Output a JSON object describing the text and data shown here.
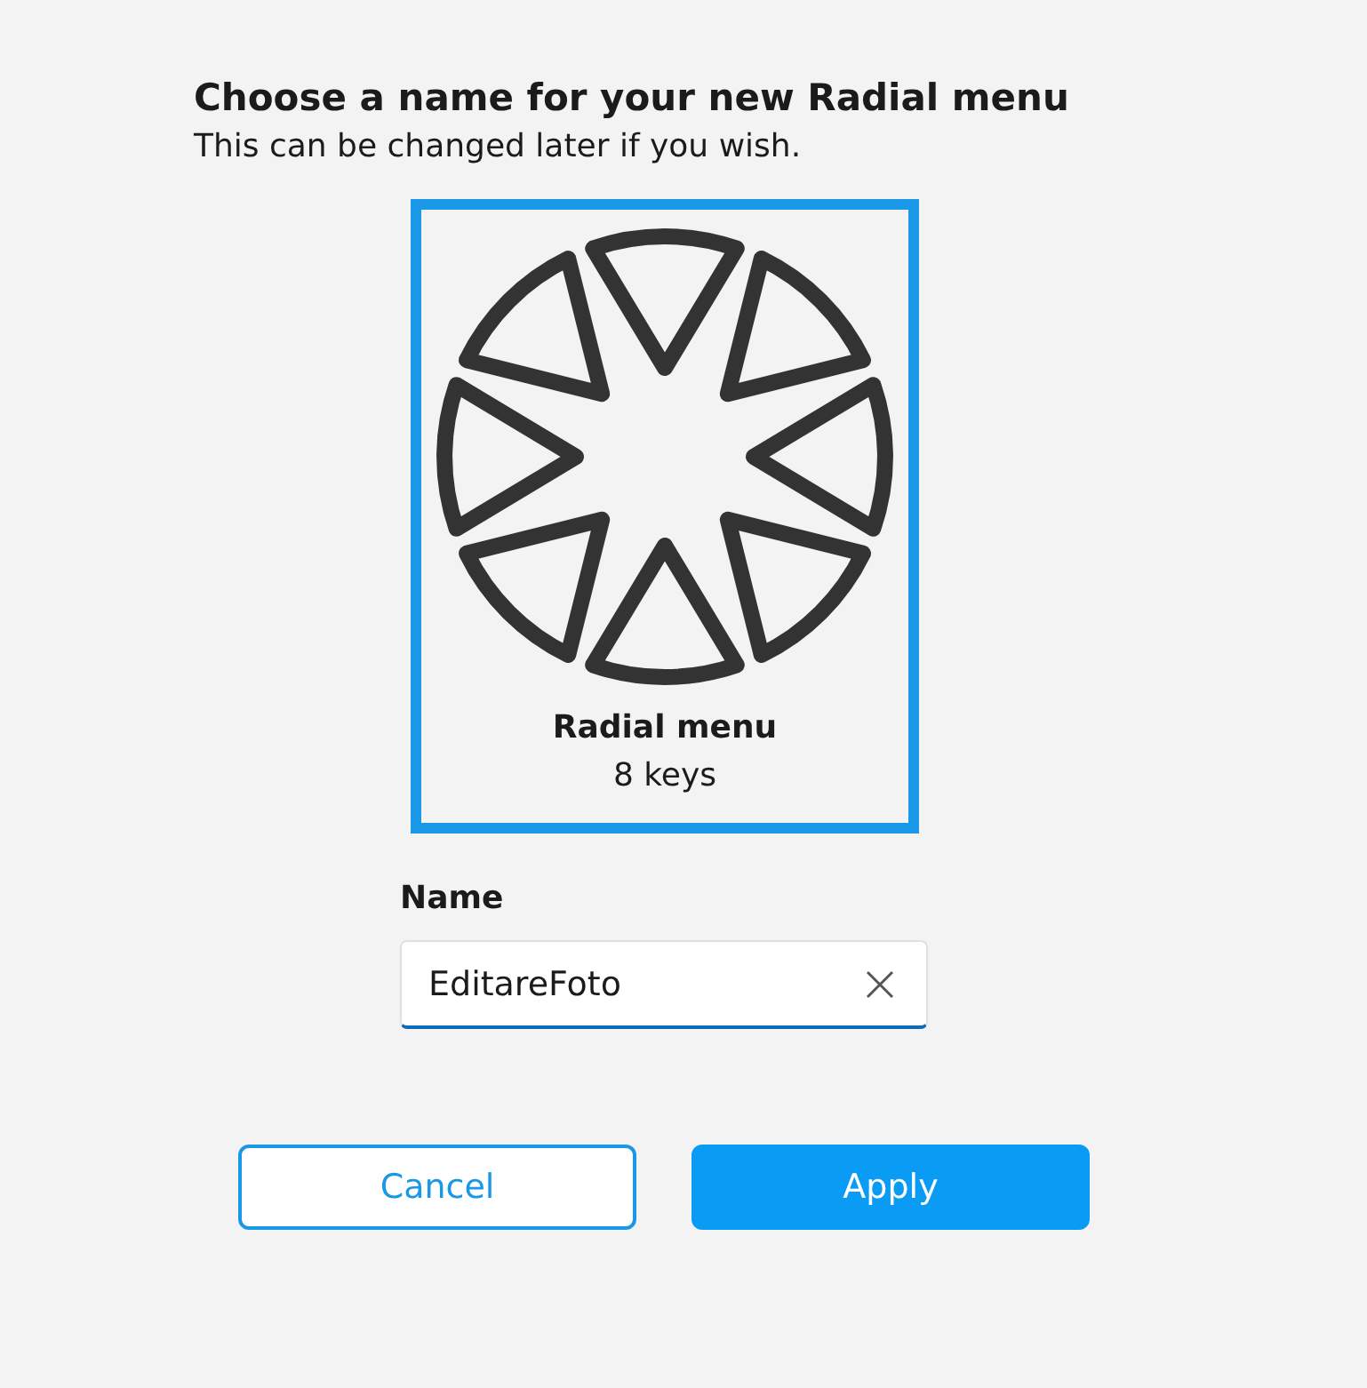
{
  "heading": {
    "title": "Choose a name for your new Radial menu",
    "subtitle": "This can be changed later if you wish."
  },
  "preview": {
    "selected": true,
    "label": "Radial menu",
    "sublabel": "8 keys"
  },
  "name_field": {
    "label": "Name",
    "value": "EditareFoto"
  },
  "buttons": [
    {
      "label": "Cancel",
      "kind": "secondary"
    },
    {
      "label": "Apply",
      "kind": "primary"
    }
  ]
}
